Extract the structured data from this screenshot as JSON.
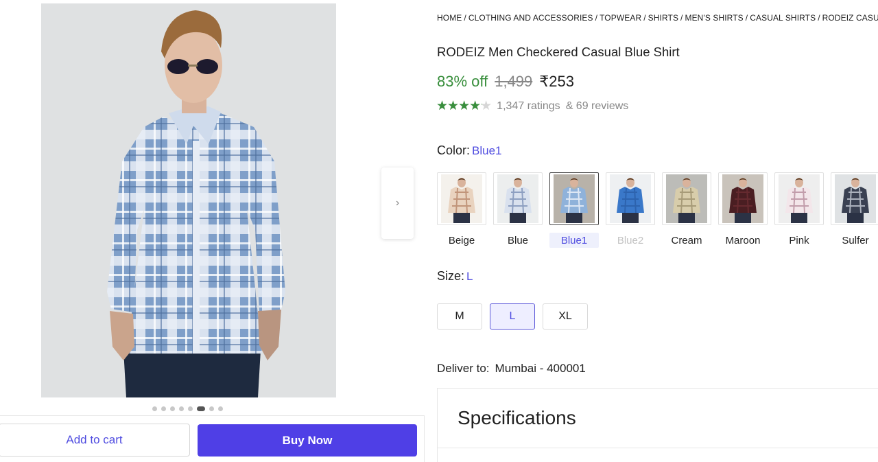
{
  "breadcrumb": [
    "HOME",
    "CLOTHING AND ACCESSORIES",
    "TOPWEAR",
    "SHIRTS",
    "MEN'S SHIRTS",
    "CASUAL SHIRTS",
    "RODEIZ CASUAL SHIRTS"
  ],
  "product": {
    "title": "RODEIZ Men Checkered Casual Blue Shirt",
    "discount": "83% off",
    "mrp": "1,499",
    "price": "₹253",
    "rating_value": 4.2,
    "ratings_text": "1,347 ratings",
    "reviews_text": "& 69 reviews"
  },
  "gallery": {
    "image_count": 8,
    "active_index": 5,
    "next_icon": "chevron-right-icon"
  },
  "color": {
    "label": "Color:",
    "selected": "Blue1",
    "options": [
      {
        "name": "Beige",
        "shirt": "#e9d3bf",
        "check": "#b8866a",
        "bg": "#f4f1ec",
        "state": "normal"
      },
      {
        "name": "Blue",
        "shirt": "#d9e1ee",
        "check": "#7b8fb6",
        "bg": "#eceeee",
        "state": "normal"
      },
      {
        "name": "Blue1",
        "shirt": "#8fb2da",
        "check": "#f1f5fb",
        "bg": "#b8b2a9",
        "state": "selected"
      },
      {
        "name": "Blue2",
        "shirt": "#3a78c9",
        "check": "#2a5ea8",
        "bg": "#eef0f2",
        "state": "disabled"
      },
      {
        "name": "Cream",
        "shirt": "#d8cdab",
        "check": "#9c8f6c",
        "bg": "#bcbcb8",
        "state": "normal"
      },
      {
        "name": "Maroon",
        "shirt": "#4a1e22",
        "check": "#6d2e33",
        "bg": "#c9c3bb",
        "state": "normal"
      },
      {
        "name": "Pink",
        "shirt": "#f3e6ea",
        "check": "#b68c9c",
        "bg": "#eeeeee",
        "state": "normal"
      },
      {
        "name": "Sulfer",
        "shirt": "#3a4152",
        "check": "#c9cfd8",
        "bg": "#dfe2e4",
        "state": "normal"
      }
    ]
  },
  "size": {
    "label": "Size:",
    "selected": "L",
    "options": [
      "M",
      "L",
      "XL"
    ]
  },
  "delivery": {
    "label": "Deliver to:",
    "location": "Mumbai - 400001"
  },
  "specifications": {
    "title": "Specifications"
  },
  "actions": {
    "add_to_cart": "Add to cart",
    "buy_now": "Buy Now"
  },
  "colors": {
    "accent": "#4f4ce0",
    "buy_button": "#4f3fe6",
    "discount_green": "#388e3c",
    "muted": "#878787"
  }
}
